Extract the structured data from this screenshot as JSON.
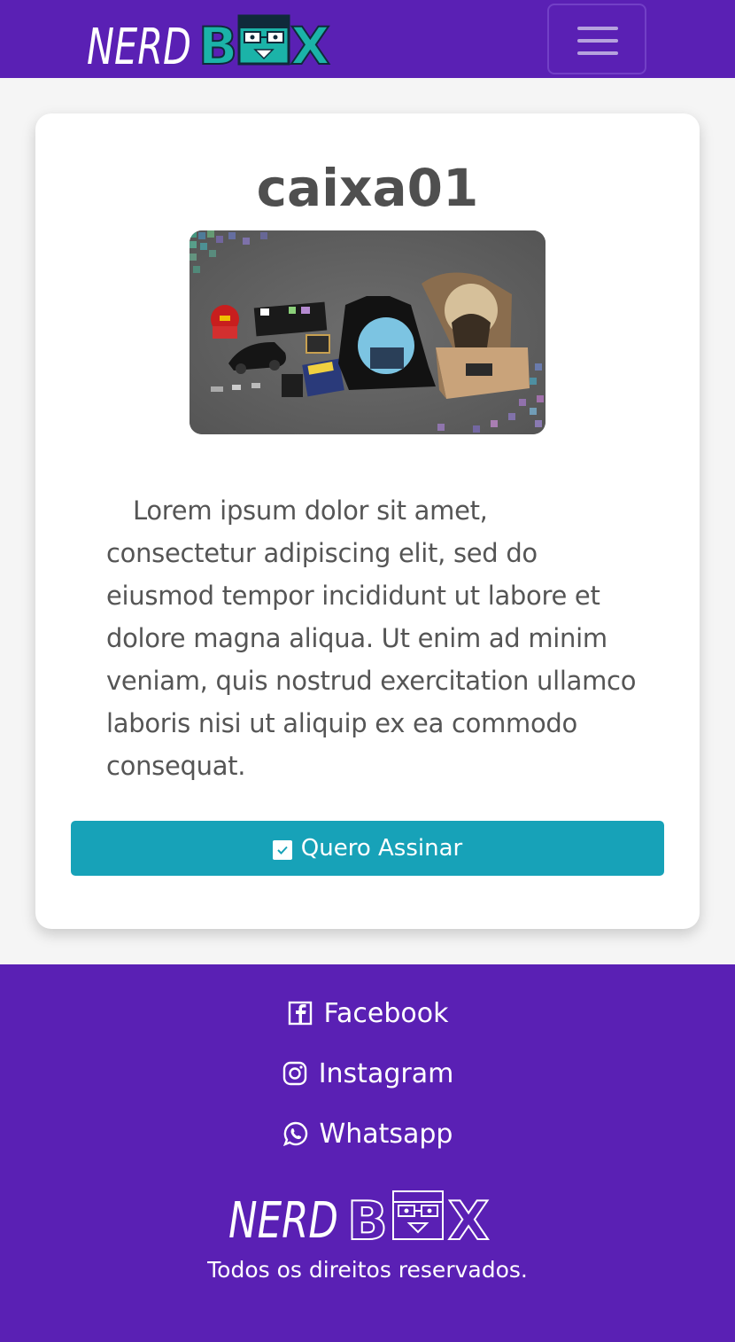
{
  "header": {
    "logo_text": "NERD BOX",
    "menu_toggle": "toggle-menu"
  },
  "card": {
    "title": "caixa01",
    "image_alt": "caixa01",
    "description": "Lorem ipsum dolor sit amet, consectetur adipiscing elit, sed do eiusmod tempor incididunt ut labore et dolore magna aliqua. Ut enim ad minim veniam, quis nostrud exercitation ullamco laboris nisi ut aliquip ex ea commodo consequat.",
    "button_label": "Quero Assinar",
    "button_icon": "check-square-icon"
  },
  "footer": {
    "links": [
      {
        "label": "Facebook",
        "icon": "facebook-icon"
      },
      {
        "label": "Instagram",
        "icon": "instagram-icon"
      },
      {
        "label": "Whatsapp",
        "icon": "whatsapp-icon"
      }
    ],
    "logo_text": "NERD BOX",
    "copyright": "Todos os direitos reservados."
  },
  "colors": {
    "brand_purple": "#5a20b4",
    "accent_teal": "#17a2b8",
    "logo_teal": "#1bb3a8"
  }
}
